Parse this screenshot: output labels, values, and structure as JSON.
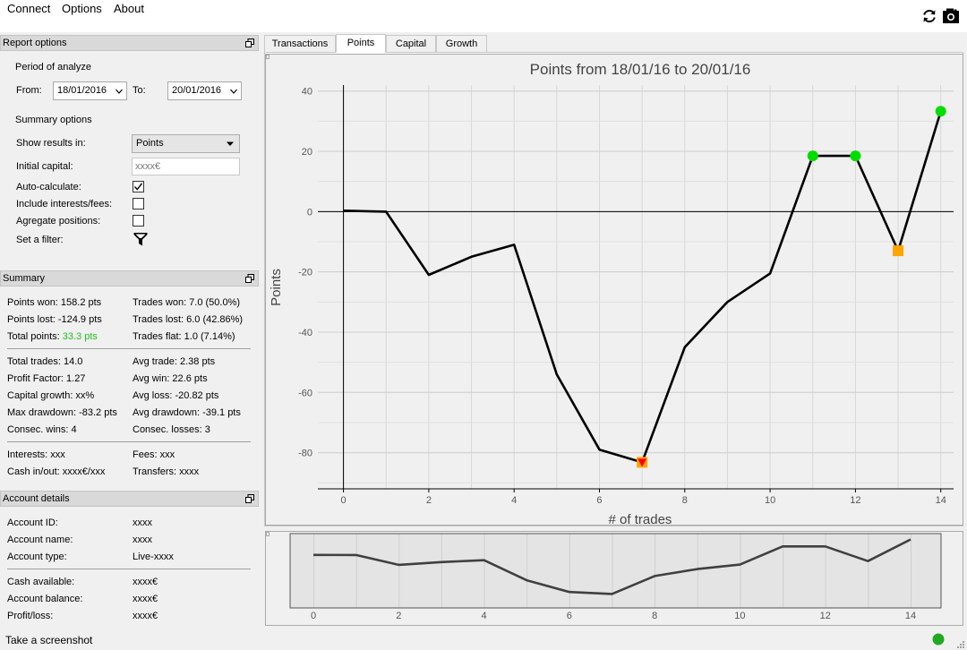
{
  "menu": {
    "connect": "Connect",
    "options": "Options",
    "about": "About"
  },
  "toolbar": {
    "refresh_icon": "refresh-icon",
    "camera_icon": "camera-icon"
  },
  "report_options": {
    "header": "Report options",
    "period_label": "Period of analyze",
    "from_label": "From:",
    "from_value": "18/01/2016",
    "to_label": "To:",
    "to_value": "20/01/2016",
    "summary_options_label": "Summary options",
    "show_results_label": "Show results in:",
    "show_results_value": "Points",
    "initial_capital_label": "Initial capital:",
    "initial_capital_placeholder": "xxxx€",
    "auto_calculate_label": "Auto-calculate:",
    "auto_calculate_checked": true,
    "include_interests_label": "Include interests/fees:",
    "include_interests_checked": false,
    "aggregate_label": "Agregate positions:",
    "aggregate_checked": false,
    "filter_label": "Set a filter:"
  },
  "summary": {
    "header": "Summary",
    "points_won": "Points won: 158.2 pts",
    "points_lost": "Points lost: -124.9 pts",
    "total_points_label": "Total points: ",
    "total_points_value": "33.3 pts",
    "trades_won": "Trades won: 7.0 (50.0%)",
    "trades_lost": "Trades lost: 6.0 (42.86%)",
    "trades_flat": "Trades flat: 1.0 (7.14%)",
    "total_trades": "Total trades: 14.0",
    "profit_factor": "Profit Factor: 1.27",
    "capital_growth": "Capital growth: xx%",
    "max_drawdown": "Max drawdown: -83.2 pts",
    "consec_wins": "Consec. wins: 4",
    "avg_trade": "Avg trade: 2.38 pts",
    "avg_win": "Avg win: 22.6 pts",
    "avg_loss": "Avg loss: -20.82 pts",
    "avg_drawdown": "Avg drawdown: -39.1 pts",
    "consec_losses": "Consec. losses: 3",
    "interests": "Interests: xxx",
    "cash_inout": "Cash in/out: xxxx€/xxx",
    "fees": "Fees: xxx",
    "transfers": "Transfers: xxxx"
  },
  "account": {
    "header": "Account details",
    "id_label": "Account ID:",
    "id_value": "xxxx",
    "name_label": "Account name:",
    "name_value": "xxxx",
    "type_label": "Account type:",
    "type_value": "Live-xxxx",
    "cash_label": "Cash available:",
    "cash_value": "xxxx€",
    "balance_label": "Account balance:",
    "balance_value": "xxxx€",
    "pl_label": "Profit/loss:",
    "pl_value": "xxxx€"
  },
  "tabs": [
    {
      "label": "Transactions"
    },
    {
      "label": "Points"
    },
    {
      "label": "Capital"
    },
    {
      "label": "Growth"
    }
  ],
  "status": {
    "text": "Take a screenshot",
    "indicator_color": "#22a822"
  },
  "chart_data": {
    "type": "line",
    "title": "Points from 18/01/16 to 20/01/16",
    "xlabel": "# of trades",
    "ylabel": "Points",
    "xlim": [
      -0.6,
      14.3
    ],
    "ylim": [
      -92,
      42
    ],
    "x_ticks": [
      0,
      2,
      4,
      6,
      8,
      10,
      12,
      14
    ],
    "y_ticks": [
      -80,
      -60,
      -40,
      -20,
      0,
      20,
      40
    ],
    "grid": true,
    "series": [
      {
        "x": [
          0,
          1,
          2,
          3,
          4,
          5,
          6,
          7,
          8,
          9,
          10,
          11,
          12,
          13,
          14
        ],
        "values": [
          0.3,
          0,
          -21,
          -15,
          -11,
          -54,
          -79,
          -83.2,
          -45,
          -30,
          -20.5,
          18.5,
          18.5,
          -13,
          33.3
        ],
        "color": "#000000"
      }
    ],
    "markers": [
      {
        "x": 7,
        "y": -83.2,
        "shape": "square",
        "color": "#ffa500"
      },
      {
        "x": 7,
        "y": -83.2,
        "shape": "triangle-down",
        "color": "#ff0000"
      },
      {
        "x": 11,
        "y": 18.5,
        "shape": "circle",
        "color": "#00dd00"
      },
      {
        "x": 12,
        "y": 18.5,
        "shape": "circle",
        "color": "#00dd00"
      },
      {
        "x": 13,
        "y": -13,
        "shape": "square",
        "color": "#ffa500"
      },
      {
        "x": 14,
        "y": 33.3,
        "shape": "circle",
        "color": "#00dd00"
      }
    ],
    "overview": {
      "x_ticks": [
        0,
        2,
        4,
        6,
        8,
        10,
        12,
        14
      ],
      "series_color": "#404040"
    }
  }
}
